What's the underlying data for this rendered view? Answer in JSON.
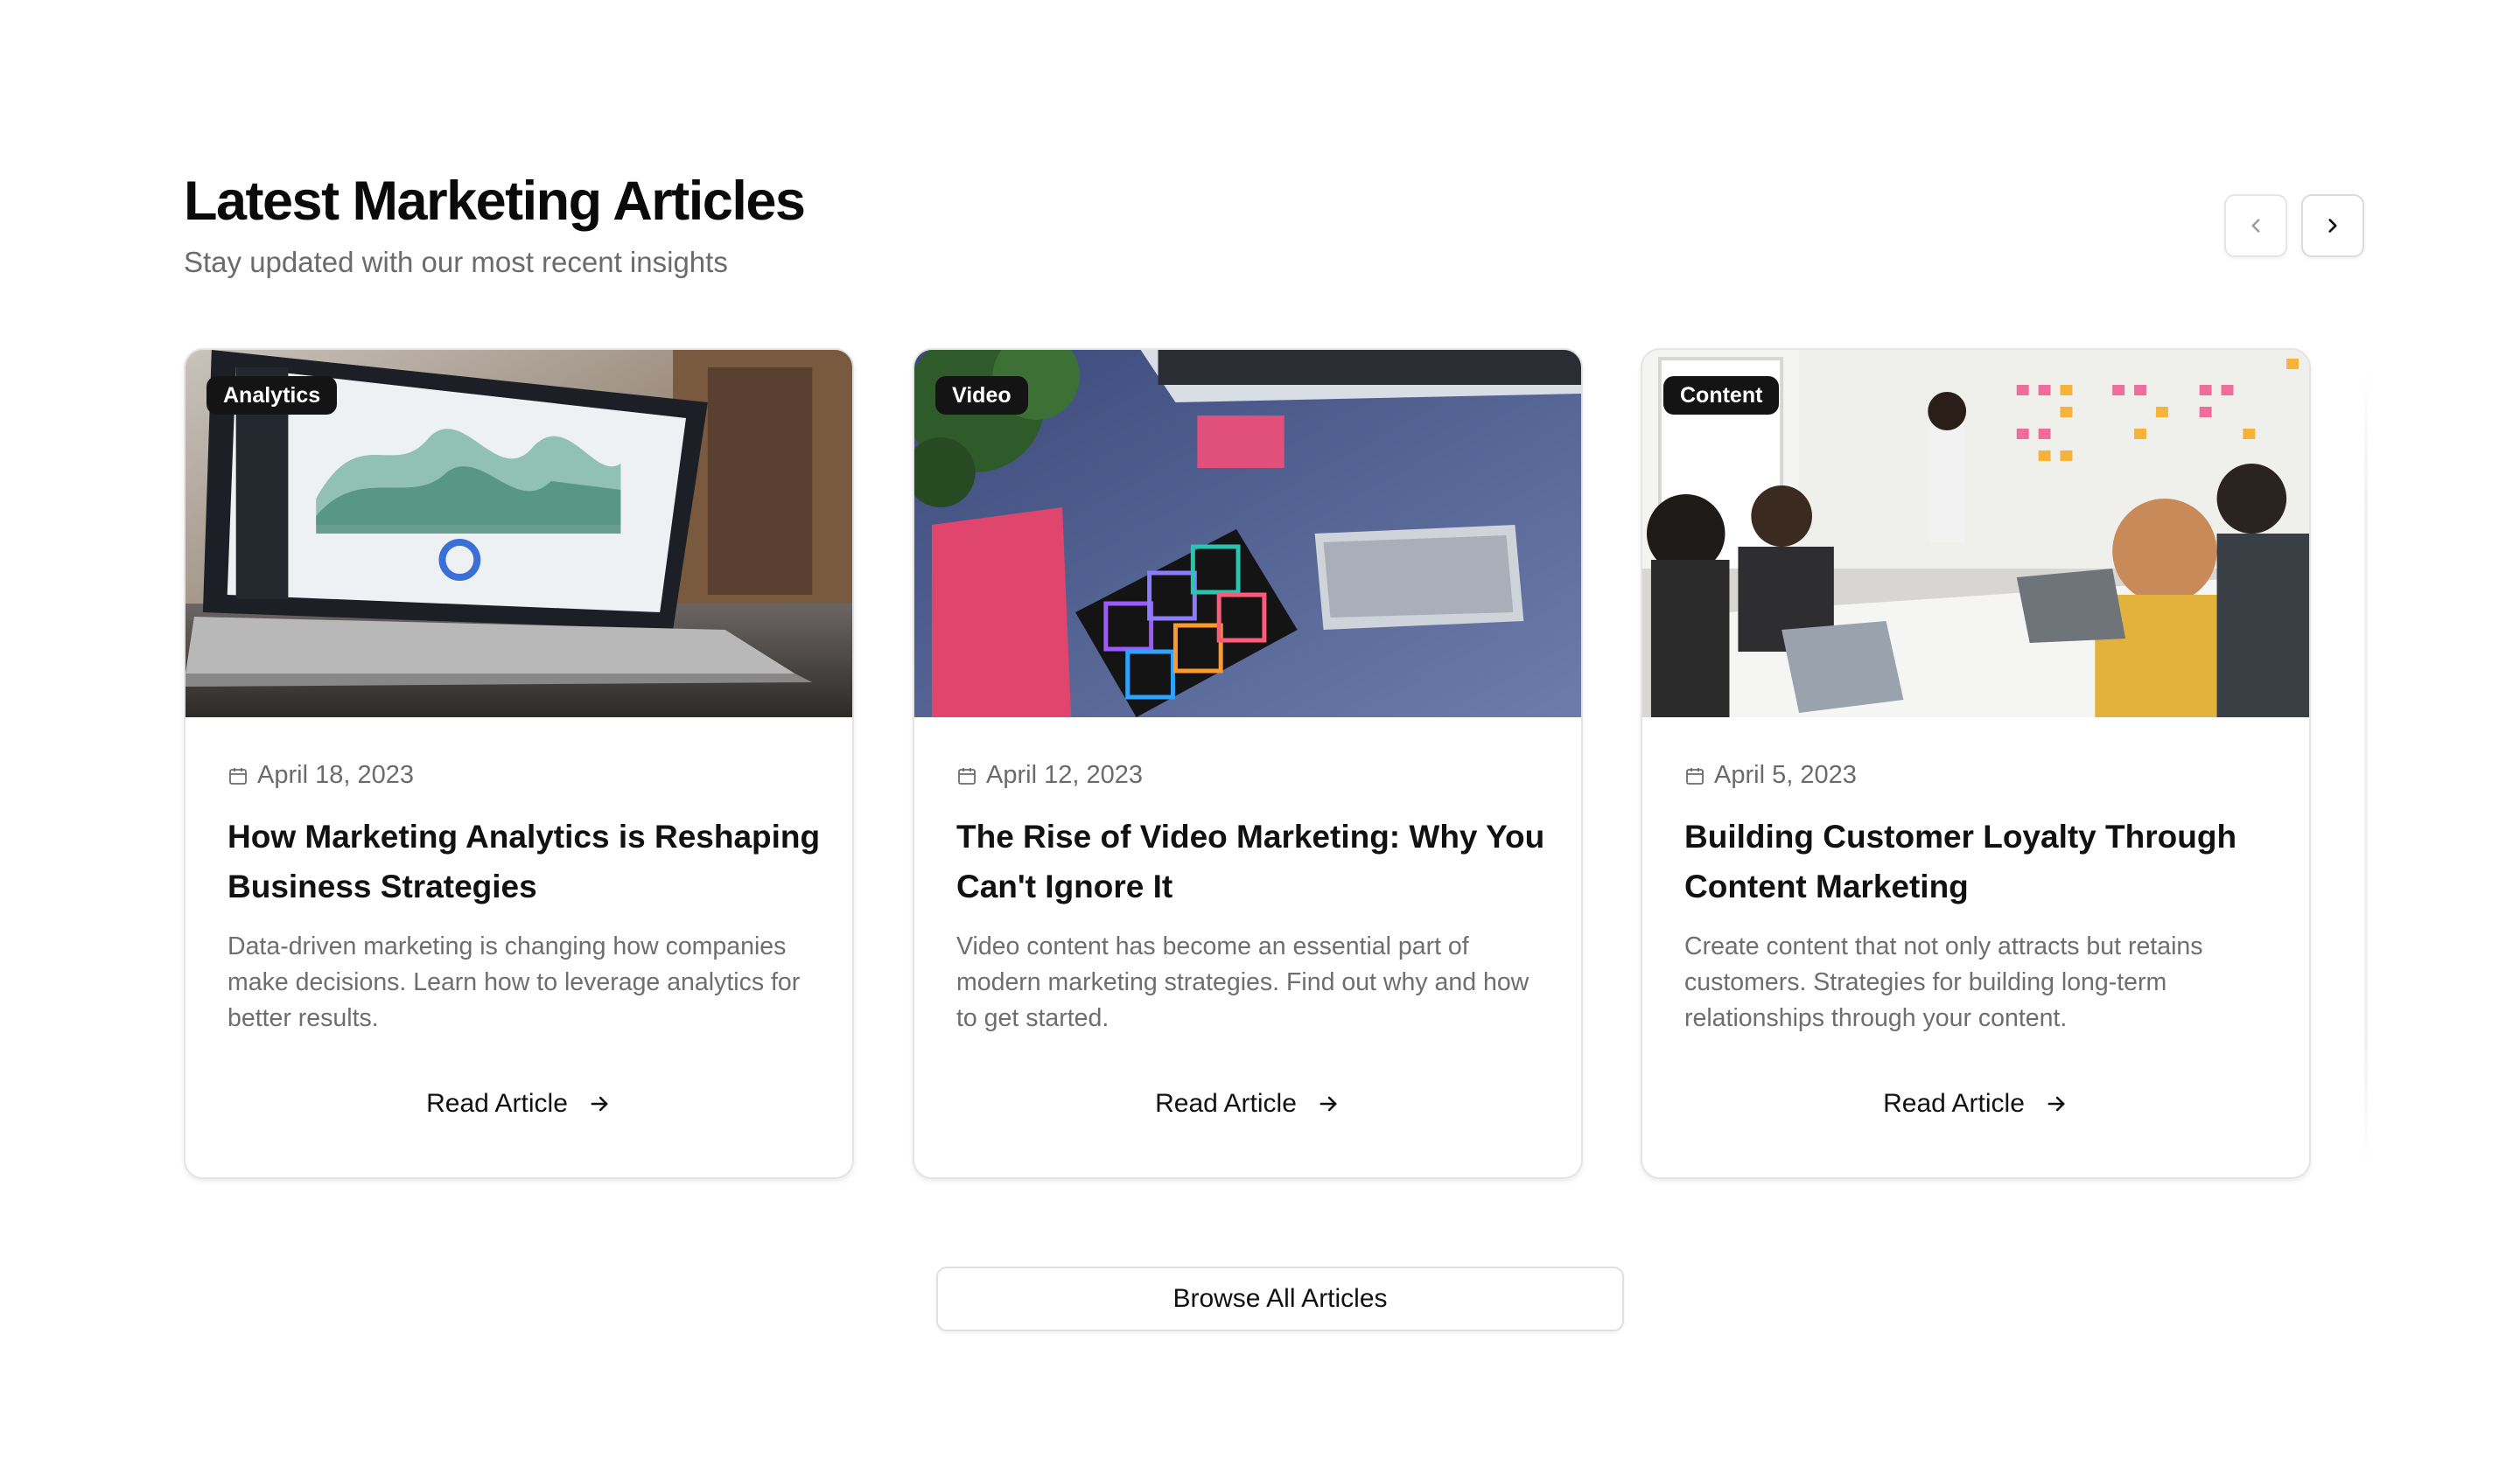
{
  "header": {
    "title": "Latest Marketing Articles",
    "subtitle": "Stay updated with our most recent insights"
  },
  "nav": {
    "prev_icon": "chevron-left-icon",
    "next_icon": "chevron-right-icon"
  },
  "articles": [
    {
      "category": "Analytics",
      "date": "April 18, 2023",
      "title": "How Marketing Analytics is Reshaping Business Strategies",
      "excerpt": "Data-driven marketing is changing how companies make decisions. Learn how to leverage analytics for better results.",
      "link_label": "Read Article",
      "image": "laptop-analytics-dashboard"
    },
    {
      "category": "Video",
      "date": "April 12, 2023",
      "title": "The Rise of Video Marketing: Why You Can't Ignore It",
      "excerpt": "Video content has become an essential part of modern marketing strategies. Find out why and how to get started.",
      "link_label": "Read Article",
      "image": "desk-with-creative-apps-tablet"
    },
    {
      "category": "Content",
      "date": "April 5, 2023",
      "title": "Building Customer Loyalty Through Content Marketing",
      "excerpt": "Create content that not only attracts but retains customers. Strategies for building long-term relationships through your content.",
      "link_label": "Read Article",
      "image": "team-meeting-sticky-notes"
    }
  ],
  "browse": {
    "label": "Browse All Articles"
  },
  "colors": {
    "text_primary": "#111111",
    "text_muted": "#6b6b6b",
    "badge_bg": "#141414",
    "border": "#e4e4e4"
  }
}
